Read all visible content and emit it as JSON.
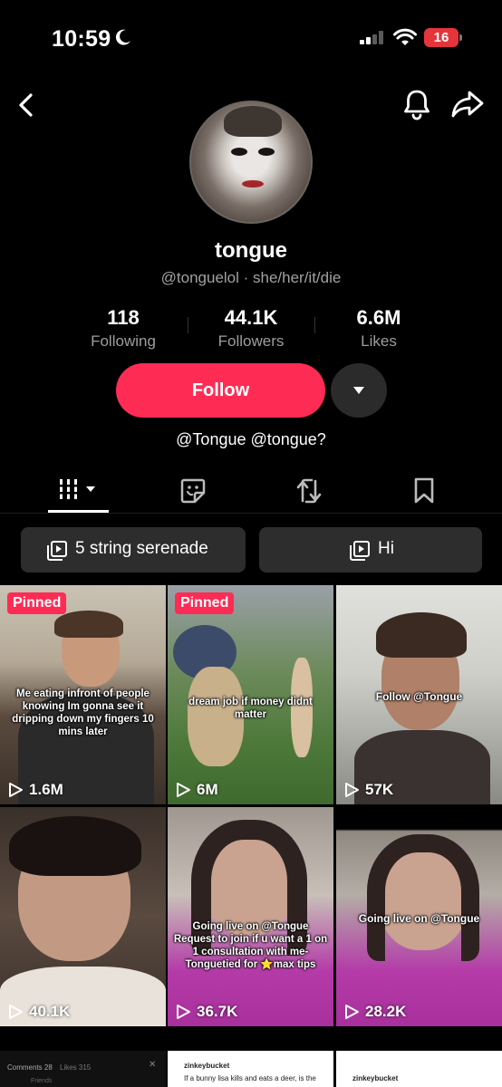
{
  "status_bar": {
    "time": "10:59",
    "battery": "16"
  },
  "profile": {
    "username": "tongue",
    "handle_line": "@tonguelol · she/her/it/die",
    "bio": "@Tongue @tongue?"
  },
  "stats": [
    {
      "value": "118",
      "label": "Following"
    },
    {
      "value": "44.1K",
      "label": "Followers"
    },
    {
      "value": "6.6M",
      "label": "Likes"
    }
  ],
  "actions": {
    "follow_label": "Follow"
  },
  "playlists": [
    {
      "label": "5 string serenade"
    },
    {
      "label": "Hi"
    }
  ],
  "videos": [
    {
      "pinned": "Pinned",
      "caption": "Me eating infront of people knowing Im gonna see it dripping down my fingers 10 mins later",
      "views": "1.6M"
    },
    {
      "pinned": "Pinned",
      "caption": "dream job if money didnt matter",
      "views": "6M"
    },
    {
      "caption": "Follow @Tongue",
      "views": "57K"
    },
    {
      "caption": "",
      "views": "40.1K"
    },
    {
      "caption": "Going live on @Tongue Request to join if u want a 1 on 1 consultation with me- Tonguetied for ⭐max tips",
      "views": "36.7K"
    },
    {
      "caption": "Going live on @Tongue",
      "views": "28.2K"
    }
  ],
  "peek": {
    "comments_label": "Comments 28",
    "likes_label": "Likes 315",
    "friends_label": "Friends",
    "user_a": "zinkeybucket",
    "user_a_text": "If a bunny lisa kills and eats a deer, is the",
    "user_b": "zinkeybucket"
  },
  "colors": {
    "accent": "#fe2c55",
    "background": "#000000",
    "secondary_text": "#a1a1a1",
    "chip": "#2d2d2d"
  }
}
